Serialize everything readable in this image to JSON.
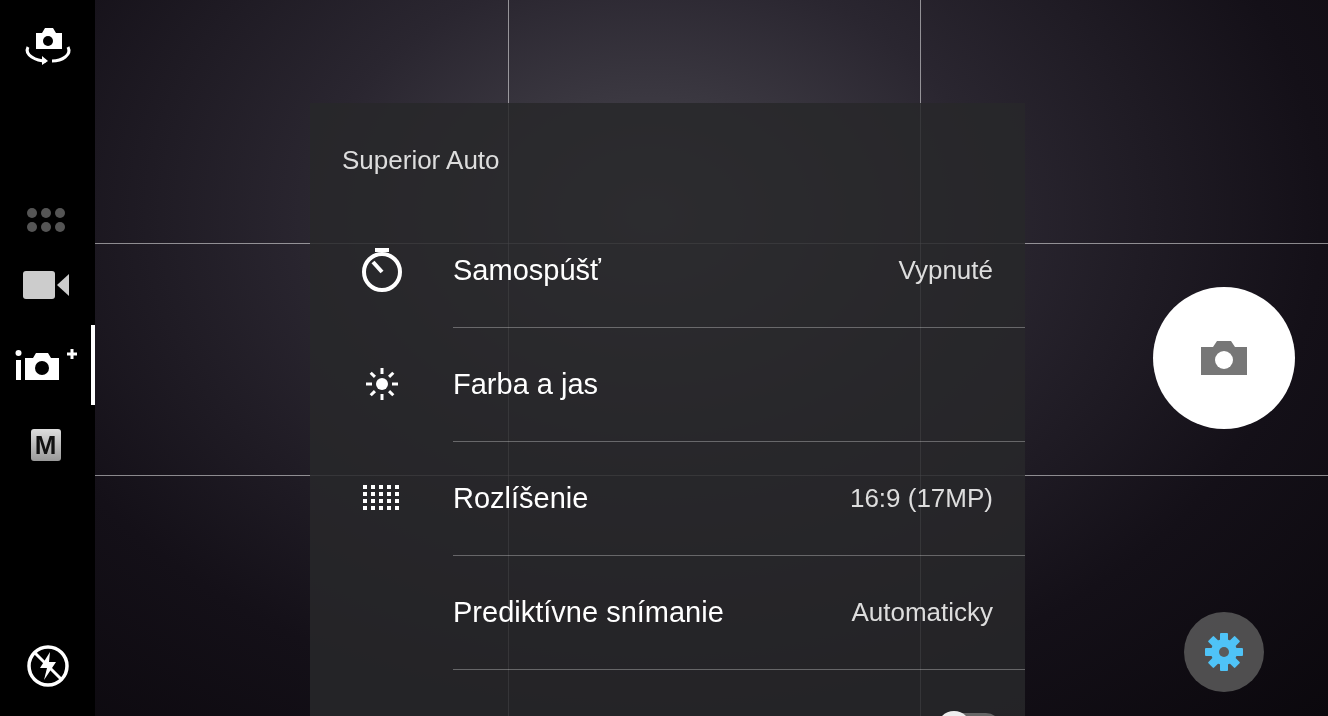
{
  "modes": [
    {
      "kind": "more",
      "selected": false
    },
    {
      "kind": "video",
      "selected": false
    },
    {
      "kind": "superior",
      "selected": true
    },
    {
      "kind": "manual",
      "label": "M",
      "selected": false
    }
  ],
  "menu": {
    "title": "Superior Auto",
    "rows": [
      {
        "kind": "timer",
        "label": "Samospúšť",
        "value": "Vypnuté"
      },
      {
        "kind": "brightness",
        "label": "Farba a jas"
      },
      {
        "kind": "resolution",
        "label": "Rozlíšenie",
        "value": "16:9 (17MP)"
      },
      {
        "kind": "plain",
        "label": "Prediktívne snímanie",
        "value": "Automaticky"
      },
      {
        "kind": "toggle",
        "on": false
      }
    ]
  }
}
